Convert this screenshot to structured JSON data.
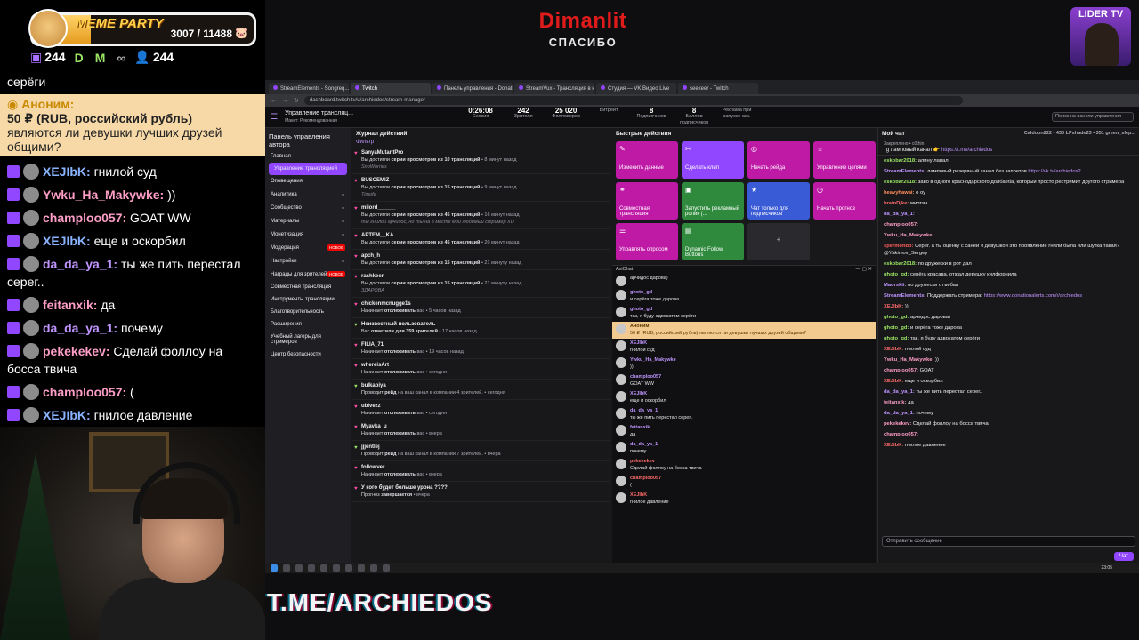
{
  "goal": {
    "title": "MEME PARTY",
    "current": "3007 / 11488",
    "progress": 0.262
  },
  "stats": {
    "subs": "244",
    "followers": "244"
  },
  "banner": {
    "name": "Dimanlit",
    "thanks": "СПАСИБО"
  },
  "corner_badge": "LIDER TV",
  "overlay_chat": {
    "top_fragment": "серёги",
    "donation": {
      "author": "Аноним:",
      "amount": "50 ₽ (RUB, российский рубль)",
      "text": "являются ли девушки лучших друзей общими?"
    },
    "messages": [
      {
        "user": "XEJIbK:",
        "text": "гнилой суд",
        "color": "#8ab4ff"
      },
      {
        "user": "Ywku_Ha_Makywke:",
        "text": "))",
        "color": "#ff9ec7"
      },
      {
        "user": "champloo057:",
        "text": "GOAT WW",
        "color": "#ff9ec7"
      },
      {
        "user": "XEJIbK:",
        "text": "еще и оскорбил",
        "color": "#8ab4ff"
      },
      {
        "user": "da_da_ya_1:",
        "text": "ты же пить перестал серег..",
        "color": "#bf94ff"
      },
      {
        "user": "feitanxik:",
        "text": "да",
        "color": "#ff9ec7"
      },
      {
        "user": "da_da_ya_1:",
        "text": "почему",
        "color": "#bf94ff"
      },
      {
        "user": "pekekekev:",
        "text": "Сделай фоллоу на босса твича",
        "color": "#ff9ec7"
      },
      {
        "user": "champloo057:",
        "text": "(",
        "color": "#ff9ec7"
      },
      {
        "user": "XEJIbK:",
        "text": "гнилое давление",
        "color": "#8ab4ff"
      }
    ]
  },
  "browser": {
    "tabs": [
      "StreamElements - Songreq...",
      "Twitch",
      "Панель управления - DonationAl...",
      "StreamVux - Трансляция в неск...",
      "Студия — VK Видео Live",
      "seekeer - Twitch"
    ],
    "url": "dashboard.twitch.tv/u/archiedos/stream-manager"
  },
  "twitch_header": {
    "title": "Управление трансляц...",
    "subtitle": "Макет: Рекомендованная",
    "stats": [
      {
        "value": "0:26:08",
        "label": "Сессия"
      },
      {
        "value": "242",
        "label": "Зрителя"
      },
      {
        "value": "25 020",
        "label": "Фолловеров"
      },
      {
        "value": "",
        "label": "Битрейт"
      },
      {
        "value": "8",
        "label": "Подписчиков"
      },
      {
        "value": "8",
        "label": "Баллов подписчиков"
      },
      {
        "value": "",
        "label": "Реклама при запуске акк."
      }
    ],
    "search_placeholder": "Поиск на панели управления"
  },
  "sidenav": {
    "heading": "Панель управления автора",
    "items": [
      {
        "label": "Главная",
        "badge": ""
      },
      {
        "label": "Управление трансляцией",
        "badge": ""
      },
      {
        "label": "Оповещения",
        "badge": ""
      },
      {
        "label": "Аналитика",
        "badge": ""
      },
      {
        "label": "Сообщество",
        "badge": ""
      },
      {
        "label": "Материалы",
        "badge": ""
      },
      {
        "label": "Монетизация",
        "badge": ""
      },
      {
        "label": "Модерация",
        "badge": "НОВОЕ"
      },
      {
        "label": "Настройки",
        "badge": ""
      },
      {
        "label": "Награды для зрителей",
        "badge": "НОВОЕ"
      },
      {
        "label": "Совместная трансляция",
        "badge": ""
      },
      {
        "label": "Инструменты трансляции",
        "badge": ""
      },
      {
        "label": "Благотворительность",
        "badge": ""
      },
      {
        "label": "Расширения",
        "badge": ""
      },
      {
        "label": "Учебный лагерь для стримеров",
        "badge": ""
      },
      {
        "label": "Центр безопасности",
        "badge": ""
      }
    ]
  },
  "activity": {
    "heading": "Журнал действий",
    "filter": "Фильтр",
    "items": [
      {
        "user": "SanyaMutantPro",
        "pre": "Вы достигли ",
        "bold": "серии просмотров из 10 трансляций",
        "time": " • 8 минут назад",
        "sub": "SnoWorries",
        "kind": "streak"
      },
      {
        "user": "BUSCEMIZ",
        "pre": "Вы достигли ",
        "bold": "серии просмотров из 15 трансляций",
        "time": " • 9 минут назад",
        "sub": "Timofe",
        "kind": "streak"
      },
      {
        "user": "milord______",
        "pre": "Вы достигли ",
        "bold": "серии просмотров из 45 трансляций",
        "time": " • 16 минут назад",
        "sub": "ты гнилой арчидос, но ты на 3 месте мой любимый стример XD",
        "kind": "streak"
      },
      {
        "user": "APTEM__KA",
        "pre": "Вы достигли ",
        "bold": "серии просмотров из 45 трансляций",
        "time": " • 20 минут назад",
        "sub": "",
        "kind": "streak"
      },
      {
        "user": "apch_h",
        "pre": "Вы достигли ",
        "bold": "серии просмотров из 15 трансляций",
        "time": " • 21 минуту назад",
        "sub": "",
        "kind": "streak"
      },
      {
        "user": "rashkeen",
        "pre": "Вы достигли ",
        "bold": "серии просмотров из 15 трансляций",
        "time": " • 21 минуту назад",
        "sub": "ЗДАРОВА",
        "kind": "streak"
      },
      {
        "user": "chickenmcnugge1s",
        "pre": "Начинает ",
        "bold": "отслеживать",
        "time": " вас • 5 часов назад",
        "sub": "",
        "kind": "follow"
      },
      {
        "user": "Неизвестный пользователь",
        "pre": "Вас ",
        "bold": "отметили для 359 зрителей",
        "time": " • 17 часов назад",
        "sub": "",
        "kind": "raid"
      },
      {
        "user": "FILIA_71",
        "pre": "Начинает ",
        "bold": "отслеживать",
        "time": " вас • 19 часов назад",
        "sub": "",
        "kind": "follow"
      },
      {
        "user": "whereisArt",
        "pre": "Начинает ",
        "bold": "отслеживать",
        "time": " вас • сегодня",
        "sub": "",
        "kind": "follow"
      },
      {
        "user": "bulkabiya",
        "pre": "Проводит ",
        "bold": "рейд",
        "time": " на ваш канал в компании 4 зрителей. • сегодня",
        "sub": "",
        "kind": "raid"
      },
      {
        "user": "ubivezz",
        "pre": "Начинает ",
        "bold": "отслеживать",
        "time": " вас • сегодня",
        "sub": "",
        "kind": "follow"
      },
      {
        "user": "Myavka_u",
        "pre": "Начинает ",
        "bold": "отслеживать",
        "time": " вас • вчера",
        "sub": "",
        "kind": "follow"
      },
      {
        "user": "jjjentlej",
        "pre": "Проводит ",
        "bold": "рейд",
        "time": " на ваш канал в компании 7 зрителей. • вчера",
        "sub": "",
        "kind": "raid"
      },
      {
        "user": "followver",
        "pre": "Начинает ",
        "bold": "отслеживать",
        "time": " вас • вчера",
        "sub": "",
        "kind": "follow"
      },
      {
        "user": "У кого будет больше урона ????",
        "pre": "Прогноз ",
        "bold": "завершается",
        "time": " • вчера",
        "sub": "",
        "kind": "poll"
      }
    ]
  },
  "quick_actions": {
    "heading": "Быстрые действия",
    "items": [
      {
        "label": "Изменить данные",
        "icon": "✎",
        "color": "mag"
      },
      {
        "label": "Сделать клип",
        "icon": "✂",
        "color": "vio"
      },
      {
        "label": "Начать рейда",
        "icon": "◎",
        "color": "mag"
      },
      {
        "label": "Управление целями",
        "icon": "☆",
        "color": "mag"
      },
      {
        "label": "Совместная трансляция",
        "icon": "⚭",
        "color": "mag"
      },
      {
        "label": "Запустить рекламный ролик (...",
        "icon": "▣",
        "color": "grn"
      },
      {
        "label": "Чат только для подписчиков",
        "icon": "★",
        "color": "blu"
      },
      {
        "label": "Начать прогноз",
        "icon": "◷",
        "color": "mag"
      },
      {
        "label": "Управлять опросом",
        "icon": "☰",
        "color": "mag"
      },
      {
        "label": "Dynamic Follow Buttons",
        "icon": "▤",
        "color": "grn"
      },
      {
        "label": "",
        "icon": "+",
        "color": "add"
      }
    ]
  },
  "alerts_chat": {
    "title": "AxiChat",
    "messages": [
      {
        "user": "",
        "text": "арчидос дарова)",
        "kind": "msg"
      },
      {
        "user": "ghoto_gd",
        "text": "и серёга тоже дарова",
        "kind": "msg"
      },
      {
        "user": "ghoto_gd",
        "text": "так, я буду адвокатом серёги",
        "kind": "msg"
      },
      {
        "user": "Аноним",
        "text": "50 ₽ (RUB, российский рубль) являются ли девушки лучших друзей общими?",
        "kind": "donation"
      },
      {
        "user": "XEJIbK",
        "text": "гнилой суд",
        "kind": "msg"
      },
      {
        "user": "Ywku_Ha_Makywke",
        "text": "))",
        "kind": "msg"
      },
      {
        "user": "champloo057",
        "text": "GOAT WW",
        "kind": "msg"
      },
      {
        "user": "XEJIbK",
        "text": "еще и оскорбил",
        "kind": "msg"
      },
      {
        "user": "da_da_ya_1",
        "text": "ты же пить перестал серег..",
        "kind": "msg"
      },
      {
        "user": "feitanxik",
        "text": "да",
        "kind": "msg"
      },
      {
        "user": "da_da_ya_1",
        "text": "почему",
        "kind": "msg"
      },
      {
        "user": "pekekekev",
        "text": "Сделай фоллоу на босса твича",
        "kind": "msg"
      },
      {
        "user": "champloo057",
        "text": "(",
        "kind": "msg"
      },
      {
        "user": "XEJIbK",
        "text": "гнилое давление",
        "kind": "msg"
      }
    ]
  },
  "my_chat": {
    "heading": "Мой чат",
    "viewers": "Caldoon222 • 430   LPshade23 • 351   green_slep...",
    "pinned_pre": "Закреплено • c0thin",
    "pinned_text": "тg ламповый канал 👉 ",
    "pinned_link": "https://t.me/archiedos",
    "messages": [
      {
        "user": "eskobar2018:",
        "text": "алину лапал",
        "color": "#9be564",
        "link": ""
      },
      {
        "user": "StreamElements:",
        "text": "ламповый резервный канал без запретов ",
        "color": "#bf94ff",
        "link": "https://vk.tv/archiedos2"
      },
      {
        "user": "eskobar2018:",
        "text": "заво в одного краснодарского долбаеба, который просто рестримит другого стримера",
        "color": "#9be564",
        "link": ""
      },
      {
        "user": "heavyhawai:",
        "text": "о оу",
        "color": "#ff8c5a",
        "link": ""
      },
      {
        "user": "brainDjke:",
        "text": "миотян",
        "color": "#ff6b6b",
        "link": ""
      },
      {
        "user": "da_da_ya_1:",
        "text": "",
        "color": "#bf94ff",
        "link": ""
      },
      {
        "user": "champloo057:",
        "text": "",
        "color": "#ff9ec7",
        "link": ""
      },
      {
        "user": "Ywku_Ha_Makywke:",
        "text": "",
        "color": "#ff9ec7",
        "link": ""
      },
      {
        "user": "spermondo:",
        "text": "Серег. а ты оценку с саней и девушкой это проявление гнили была или шутка такая? @Yakimov_Sergey",
        "color": "#ff5c5c",
        "link": ""
      },
      {
        "user": "eskobar2018:",
        "text": "по дружески в рот дал",
        "color": "#9be564",
        "link": ""
      },
      {
        "user": "ghoto_gd:",
        "text": "серёга красава, отжал девушку килфорнила",
        "color": "#9be564",
        "link": ""
      },
      {
        "user": "Maorskii:",
        "text": "по дружески отъебал",
        "color": "#bf94ff",
        "link": ""
      },
      {
        "user": "StreamElements:",
        "text": "Поддержать стримера: ",
        "color": "#bf94ff",
        "link": "https://www.donationalerts.com/r/archiedos"
      },
      {
        "user": "XEJIbK:",
        "text": "))",
        "color": "#ff6b6b",
        "link": ""
      },
      {
        "user": "ghoto_gd:",
        "text": "арчидос дарова)",
        "color": "#9be564",
        "link": ""
      },
      {
        "user": "ghoto_gd:",
        "text": "и серёга тоже дарова",
        "color": "#9be564",
        "link": ""
      },
      {
        "user": "ghoto_gd:",
        "text": "так, я буду адвокатом серёги",
        "color": "#9be564",
        "link": ""
      },
      {
        "user": "XEJIbK:",
        "text": "гнилой суд",
        "color": "#ff6b6b",
        "link": ""
      },
      {
        "user": "Ywku_Ha_Makywke:",
        "text": "))",
        "color": "#ff9ec7",
        "link": ""
      },
      {
        "user": "champloo057:",
        "text": "GOAT",
        "color": "#ff9ec7",
        "link": ""
      },
      {
        "user": "XEJIbK:",
        "text": "еще и оскорбил",
        "color": "#ff6b6b",
        "link": ""
      },
      {
        "user": "da_da_ya_1:",
        "text": "ты же пить перестал серег..",
        "color": "#bf94ff",
        "link": ""
      },
      {
        "user": "feitanxik:",
        "text": "да",
        "color": "#ff9ec7",
        "link": ""
      },
      {
        "user": "da_da_ya_1:",
        "text": "почему",
        "color": "#bf94ff",
        "link": ""
      },
      {
        "user": "pekekekev:",
        "text": "Сделай фоллоу на босса твича",
        "color": "#ff9ec7",
        "link": ""
      },
      {
        "user": "champloo057:",
        "text": "",
        "color": "#ff9ec7",
        "link": ""
      },
      {
        "user": "XEJIbK:",
        "text": "гнилое давление",
        "color": "#ff6b6b",
        "link": ""
      }
    ],
    "input_placeholder": "Отправить сообщение",
    "send_label": "Чат"
  },
  "taskbar": {
    "time": "23:05"
  },
  "footer_text": "T.ME/ARCHIEDOS"
}
